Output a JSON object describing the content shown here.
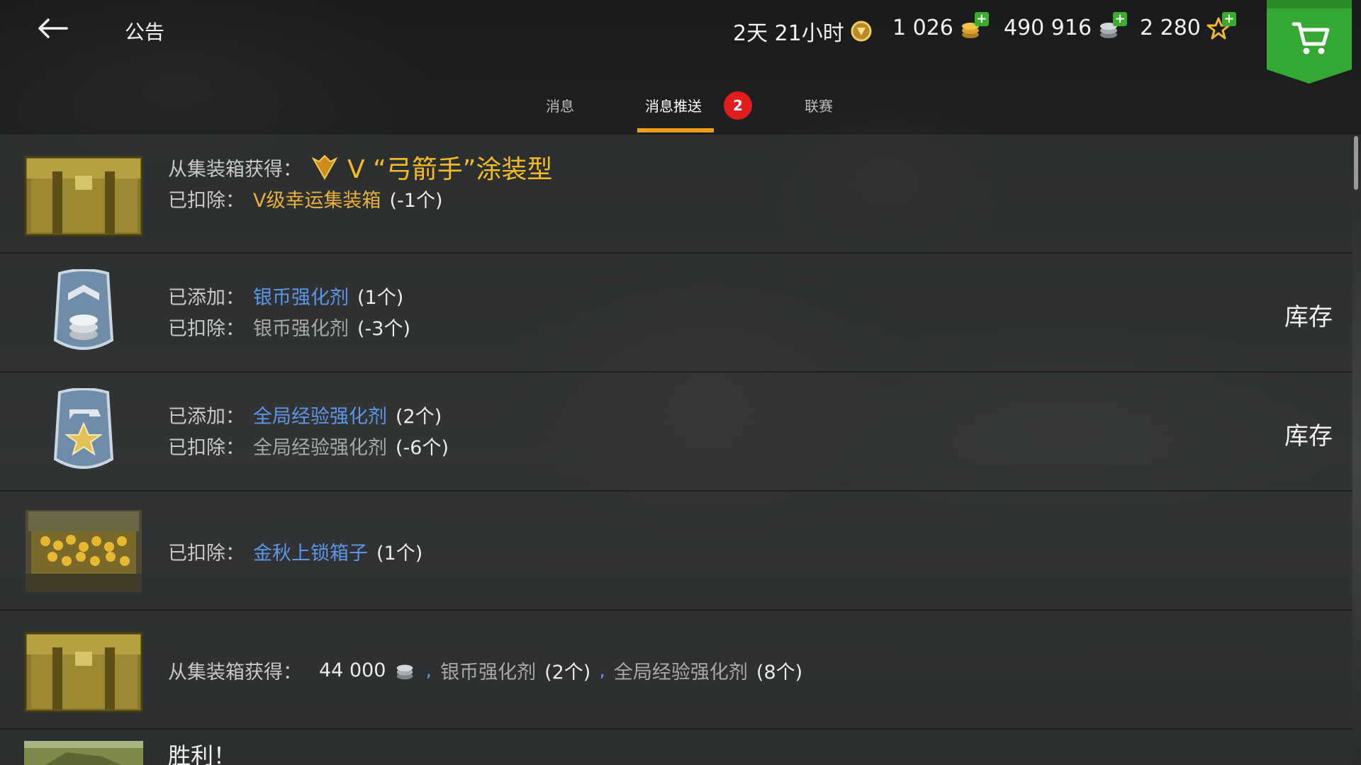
{
  "header": {
    "title": "公告",
    "back_icon": "back-arrow-icon",
    "premium_time": "2天 21小时",
    "gold": "1 026",
    "silver": "490 916",
    "free_xp": "2 280",
    "shop_icon": "cart-icon"
  },
  "tabs": [
    {
      "label": "消息"
    },
    {
      "label": "消息推送",
      "badge": "2",
      "active": true
    },
    {
      "label": "联赛"
    }
  ],
  "messages": [
    {
      "line1_label": "从集装箱获得：",
      "line1_reward": "V “弓箭手”涂装型",
      "line2_label": "已扣除：",
      "line2_item": "V级幸运集装箱",
      "line2_qty": "(-1个)"
    },
    {
      "line1_label": "已添加：",
      "line1_item": "银币强化剂",
      "line1_qty": "(1个)",
      "line2_label": "已扣除：",
      "line2_item": "银币强化剂",
      "line2_qty": "(-3个)",
      "action": "库存"
    },
    {
      "line1_label": "已添加：",
      "line1_item": "全局经验强化剂",
      "line1_qty": "(2个)",
      "line2_label": "已扣除：",
      "line2_item": "全局经验强化剂",
      "line2_qty": "(-6个)",
      "action": "库存"
    },
    {
      "line1_label": "已扣除：",
      "line1_item": "金秋上锁箱子",
      "line1_qty": "(1个)"
    },
    {
      "line1_label": "从集装箱获得：",
      "amount": "44 000",
      "comma1": ",",
      "item1": "银币强化剂",
      "qty1": "(2个)",
      "comma2": ",",
      "item2": "全局经验强化剂",
      "qty2": "(8个)"
    },
    {
      "title": "胜利！"
    }
  ],
  "colors": {
    "accent_orange": "#f0a11a",
    "badge_red": "#e01c1c",
    "shop_green": "#34a833",
    "link_blue": "#5b97e8",
    "gold_text": "#e9b13a"
  }
}
